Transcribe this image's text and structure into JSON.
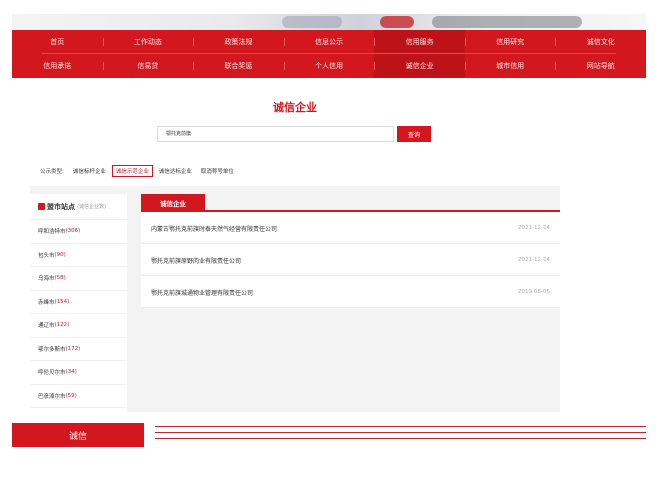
{
  "nav": {
    "row1": [
      "首页",
      "工作动态",
      "政策法规",
      "信息公示",
      "信用服务",
      "信用研究",
      "诚信文化"
    ],
    "row2": [
      "信用承诺",
      "信易贷",
      "联合奖惩",
      "个人信用",
      "诚信企业",
      "城市信用",
      "网站导航"
    ],
    "active_row1": 4,
    "active_row2": 4
  },
  "search": {
    "title": "诚信企业",
    "input_value": "鄂托克前旗",
    "button_label": "查询"
  },
  "filters": {
    "label": "公示类型:",
    "options": [
      "诚信标杆企业",
      "诚信示范企业",
      "诚信达标企业",
      "取消称号单位"
    ],
    "active": 1
  },
  "sidebar": {
    "title": "盟市站点",
    "subtitle": "(诚信企业数)",
    "items": [
      {
        "name": "呼和浩特市",
        "count": "(306)"
      },
      {
        "name": "包头市",
        "count": "(90)"
      },
      {
        "name": "乌海市",
        "count": "(58)"
      },
      {
        "name": "赤峰市",
        "count": "(154)"
      },
      {
        "name": "通辽市",
        "count": "(122)"
      },
      {
        "name": "鄂尔多斯市",
        "count": "(172)"
      },
      {
        "name": "呼伦贝尔市",
        "count": "(34)"
      },
      {
        "name": "巴彦淖尔市",
        "count": "(59)"
      }
    ]
  },
  "list": {
    "tab_label": "诚信企业",
    "rows": [
      {
        "name": "内蒙古鄂托克前旗时泰天然气经营有限责任公司",
        "date": "2021-12-24"
      },
      {
        "name": "鄂托克前旗原野肉业有限责任公司",
        "date": "2021-12-24"
      },
      {
        "name": "鄂托克前旗城通物业管理有限责任公司",
        "date": "2019-08-05"
      }
    ]
  },
  "footer": {
    "tab_label": "诚信"
  },
  "colors": {
    "brand_red": "#d2181e"
  }
}
